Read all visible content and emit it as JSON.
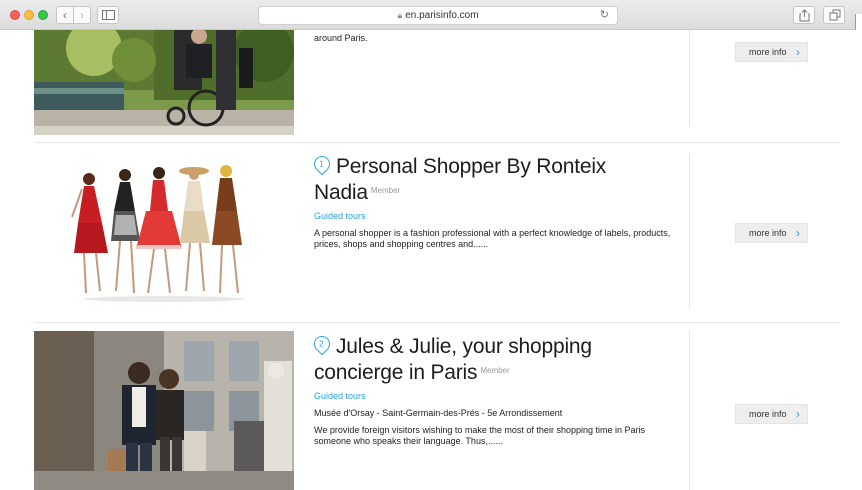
{
  "browser": {
    "url": "en.parisinfo.com",
    "icons": {
      "back": "chevron-left-icon",
      "forward": "chevron-right-icon",
      "sidebar": "sidebar-icon",
      "lock": "lock-icon",
      "reload": "reload-icon",
      "share": "share-icon",
      "tabs": "tabs-icon"
    }
  },
  "listings": [
    {
      "title": "",
      "badge": "",
      "category": "",
      "location": "",
      "description": "around Paris.",
      "button_label": "more info"
    },
    {
      "number": "1",
      "title": "Personal Shopper By Ronteix Nadia",
      "badge": "Member",
      "category": "Guided tours",
      "location": "",
      "description": "A personal shopper is a fashion professional with a perfect knowledge of labels, products, prices, shops and shopping centres and......",
      "button_label": "more info"
    },
    {
      "number": "2",
      "title": "Jules & Julie, your shopping concierge in Paris",
      "badge": "Member",
      "category": "Guided tours",
      "location": "Musée d'Orsay - Saint-Germain-des-Prés - 5e Arrondissement",
      "description": "We provide foreign visitors wishing to make the most of their shopping time in Paris someone who speaks their language. Thus,......",
      "button_label": "more info"
    }
  ],
  "colors": {
    "accent": "#2aa3dc",
    "title": "#1d1d1d",
    "button_bg": "#eeeeee"
  }
}
